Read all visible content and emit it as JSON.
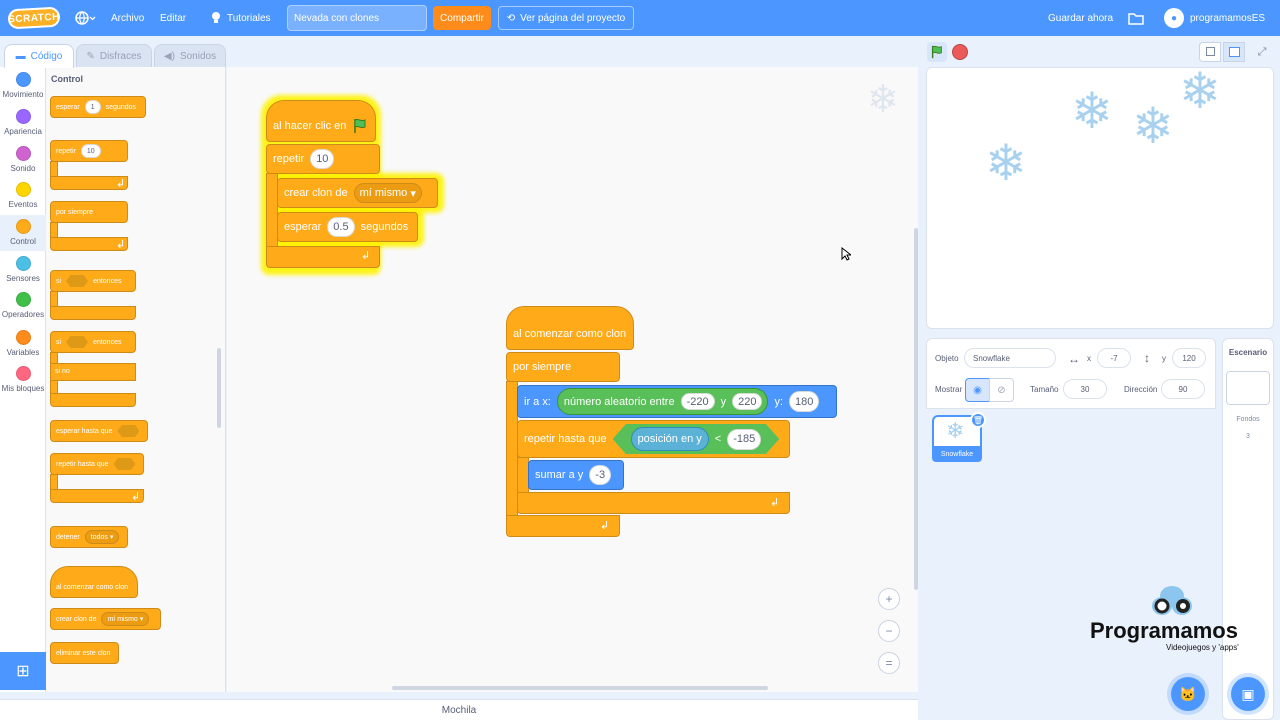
{
  "menubar": {
    "logo": "SCRATCH",
    "file": "Archivo",
    "edit": "Editar",
    "tutorials": "Tutoriales",
    "project_title": "Nevada con clones",
    "share": "Compartir",
    "see_project": "Ver página del proyecto",
    "save_now": "Guardar ahora",
    "username": "programamosES"
  },
  "tabs": {
    "code": "Código",
    "costumes": "Disfraces",
    "sounds": "Sonidos"
  },
  "categories": [
    {
      "label": "Movimiento",
      "color": "#4c97ff"
    },
    {
      "label": "Apariencia",
      "color": "#9966ff"
    },
    {
      "label": "Sonido",
      "color": "#cf63cf"
    },
    {
      "label": "Eventos",
      "color": "#ffd500"
    },
    {
      "label": "Control",
      "color": "#ffab19"
    },
    {
      "label": "Sensores",
      "color": "#4cbfe6"
    },
    {
      "label": "Operadores",
      "color": "#40bf4a"
    },
    {
      "label": "Variables",
      "color": "#ff8c1a"
    },
    {
      "label": "Mis bloques",
      "color": "#ff6680"
    }
  ],
  "palette": {
    "heading": "Control",
    "wait": "esperar",
    "wait_val": "1",
    "wait_unit": "segundos",
    "repeat": "repetir",
    "repeat_val": "10",
    "forever": "por siempre",
    "if": "si",
    "then": "entonces",
    "else": "si no",
    "wait_until": "esperar hasta que",
    "repeat_until": "repetir hasta que",
    "stop": "detener",
    "stop_val": "todos",
    "clone_start": "al comenzar como clon",
    "create_clone": "crear clon de",
    "create_clone_val": "mí mismo",
    "delete_clone": "eliminar este clon"
  },
  "script1": {
    "hat": "al hacer clic en",
    "repeat": "repetir",
    "repeat_val": "10",
    "create_clone": "crear clon de",
    "create_clone_val": "mí mismo",
    "wait": "esperar",
    "wait_val": "0.5",
    "wait_unit": "segundos"
  },
  "script2": {
    "hat": "al comenzar como clon",
    "forever": "por siempre",
    "goto": "ir a x:",
    "random": "número aleatorio entre",
    "rand_from": "-220",
    "rand_and": "y",
    "rand_to": "220",
    "y_label": "y:",
    "y_val": "180",
    "repeat_until": "repetir hasta que",
    "pos_y": "posición en y",
    "lt": "<",
    "cmp_val": "-185",
    "change_y": "sumar a y",
    "change_val": "-3"
  },
  "zoom": {
    "in": "+",
    "out": "−",
    "reset": "="
  },
  "backpack": "Mochila",
  "sprite_info": {
    "sprite_label": "Objeto",
    "sprite_name": "Snowflake",
    "x_label": "x",
    "x_val": "-7",
    "y_label": "y",
    "y_val": "120",
    "show_label": "Mostrar",
    "size_label": "Tamaño",
    "size_val": "30",
    "dir_label": "Dirección",
    "dir_val": "90"
  },
  "sprite_thumb": "Snowflake",
  "stage_pane": {
    "title": "Escenario",
    "backdrops_label": "Fondos",
    "backdrops_count": "3"
  },
  "brand": {
    "name": "Programamos",
    "tagline": "Videojuegos y 'apps'"
  }
}
